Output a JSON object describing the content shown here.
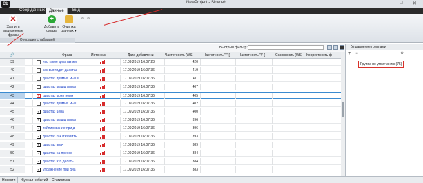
{
  "window": {
    "title": "NewProject - Slovoeb"
  },
  "tabs": [
    {
      "label": "Сбор данных"
    },
    {
      "label": "Данные"
    },
    {
      "label": "Вид"
    }
  ],
  "ribbon": {
    "buttons": [
      {
        "label": "Удалить выделенные фразы"
      },
      {
        "label": "Добавить фразы"
      },
      {
        "label": "Очистка данных ▾"
      }
    ],
    "group_label": "Операции с таблицей",
    "qat_icons": [
      "undo-icon",
      "redo-icon"
    ]
  },
  "filter": {
    "label": "Быстрый фильтр:",
    "value": ""
  },
  "grid": {
    "columns": [
      "Фраза",
      "Источник",
      "Дата добавлени",
      "Частотность [WS",
      "Частотность \" \" [",
      "Частотность \"!\" [",
      "Сезонность [WS]",
      "Корректность ф"
    ],
    "rows": [
      {
        "num": "39",
        "checked": false,
        "phrase": "что такое диастаз жи",
        "date": "17.09.2019 16:07:23",
        "freq": "420"
      },
      {
        "num": "40",
        "checked": false,
        "phrase": "как выглядит диастаз",
        "date": "17.09.2019 16:07:36",
        "freq": "419"
      },
      {
        "num": "41",
        "checked": false,
        "phrase": "диастаз прямых мышц",
        "date": "17.09.2019 16:07:36",
        "freq": "411"
      },
      {
        "num": "42",
        "checked": false,
        "phrase": "диастаз мышц живот",
        "date": "17.09.2019 16:07:36",
        "freq": "407"
      },
      {
        "num": "43",
        "checked": true,
        "phrase": "диастаз мочи норм",
        "date": "17.09.2019 16:07:36",
        "freq": "405"
      },
      {
        "num": "44",
        "checked": false,
        "phrase": "диастаз прямых мыш",
        "date": "17.09.2019 16:07:36",
        "freq": "402"
      },
      {
        "num": "45",
        "checked": true,
        "phrase": "диастаз цена",
        "date": "17.09.2019 16:07:36",
        "freq": "400"
      },
      {
        "num": "46",
        "checked": true,
        "phrase": "диастаз мышц живот",
        "date": "17.09.2019 16:07:36",
        "freq": "396"
      },
      {
        "num": "47",
        "checked": true,
        "phrase": "тейпирование при д",
        "date": "17.09.2019 16:07:36",
        "freq": "396"
      },
      {
        "num": "48",
        "checked": true,
        "phrase": "диастаз как избавить",
        "date": "17.09.2019 16:07:36",
        "freq": "393"
      },
      {
        "num": "49",
        "checked": true,
        "phrase": "диастаз врач",
        "date": "17.09.2019 16:07:36",
        "freq": "389"
      },
      {
        "num": "50",
        "checked": true,
        "phrase": "диастаз на прессе",
        "date": "17.09.2019 16:07:36",
        "freq": "384"
      },
      {
        "num": "51",
        "checked": true,
        "phrase": "диастаз что делать",
        "date": "17.09.2019 16:07:36",
        "freq": "384"
      },
      {
        "num": "52",
        "checked": true,
        "phrase": "упражнение при диа",
        "date": "17.09.2019 16:07:36",
        "freq": "383"
      }
    ]
  },
  "rightpane": {
    "title": "Управление группами",
    "tool_icons": [
      "add-icon",
      "remove-icon",
      "search-icon"
    ],
    "group": "Группа по умолчанию (75)"
  },
  "bottom_tabs": [
    "Новости",
    "Журнал событий",
    "Статистика"
  ],
  "colors": {
    "accent": "#d62b2b",
    "link": "#1e44c8",
    "selection": "#3b8bd0"
  }
}
